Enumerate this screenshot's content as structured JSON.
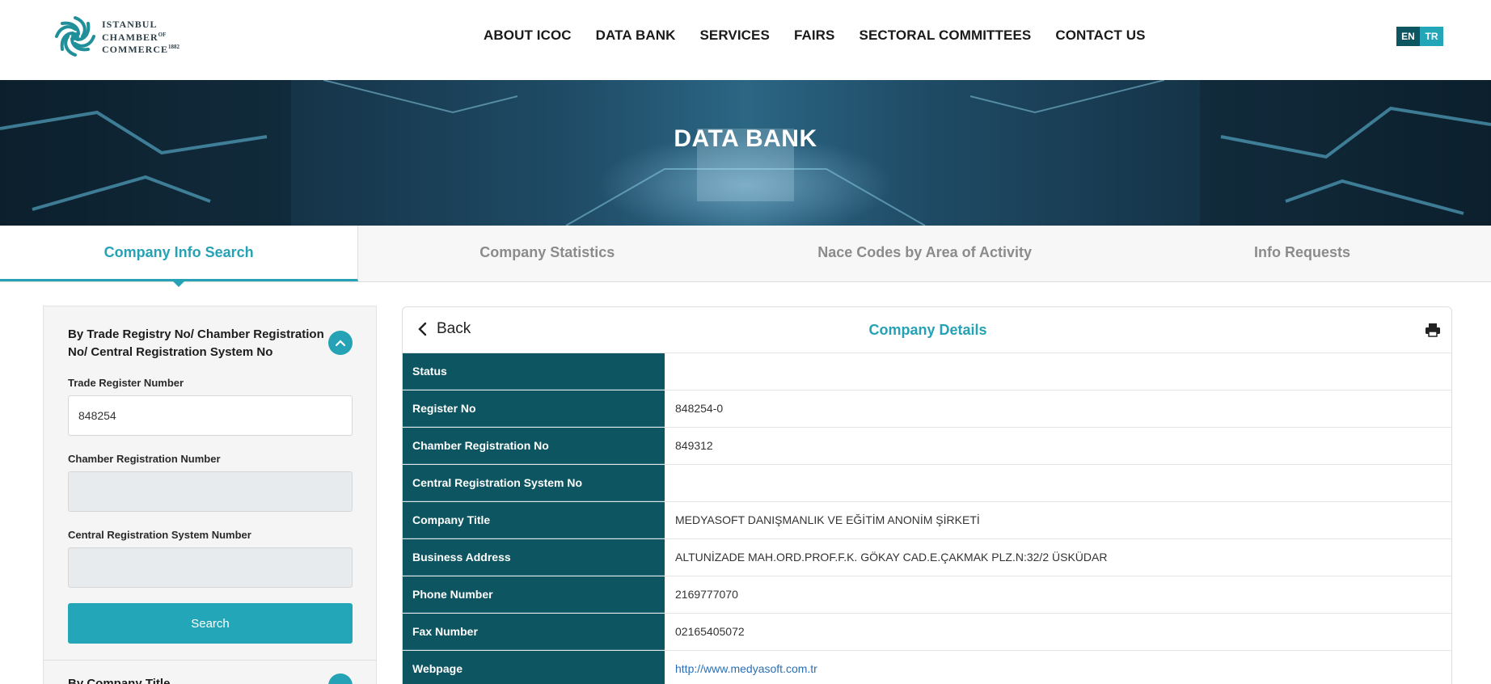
{
  "header": {
    "logo": {
      "line1": "ISTANBUL",
      "line2": "CHAMBER",
      "line2_sup": "OF",
      "line3": "COMMERCE",
      "line3_sup": "1882"
    },
    "nav": [
      {
        "label": "ABOUT ICOC"
      },
      {
        "label": "DATA BANK"
      },
      {
        "label": "SERVICES"
      },
      {
        "label": "FAIRS"
      },
      {
        "label": "SECTORAL COMMITTEES"
      },
      {
        "label": "CONTACT US"
      }
    ],
    "lang": {
      "en": "EN",
      "tr": "TR"
    }
  },
  "hero": {
    "title": "DATA BANK"
  },
  "tabs": [
    {
      "label": "Company Info Search",
      "active": true
    },
    {
      "label": "Company Statistics"
    },
    {
      "label": "Nace Codes by Area of Activity"
    },
    {
      "label": "Info Requests"
    }
  ],
  "search_panel": {
    "section_title": "By Trade Registry No/ Chamber Registration No/ Central Registration System No",
    "trade_register_label": "Trade Register Number",
    "trade_register_value": "848254",
    "chamber_registration_label": "Chamber Registration Number",
    "chamber_registration_value": "",
    "central_registration_label": "Central Registration System Number",
    "central_registration_value": "",
    "search_button": "Search",
    "section2_title": "By Company Title"
  },
  "details": {
    "back_label": "Back",
    "title": "Company Details",
    "rows": [
      {
        "key": "Status",
        "value": ""
      },
      {
        "key": "Register No",
        "value": "848254-0"
      },
      {
        "key": "Chamber Registration No",
        "value": "849312"
      },
      {
        "key": "Central Registration System No",
        "value": ""
      },
      {
        "key": "Company Title",
        "value": "MEDYASOFT DANIŞMANLIK VE EĞİTİM ANONİM ŞİRKETİ"
      },
      {
        "key": "Business Address",
        "value": "ALTUNİZADE MAH.ORD.PROF.F.K. GÖKAY CAD.E.ÇAKMAK PLZ.N:32/2 ÜSKÜDAR"
      },
      {
        "key": "Phone Number",
        "value": "2169777070"
      },
      {
        "key": "Fax Number",
        "value": "02165405072"
      },
      {
        "key": "Webpage",
        "value": "http://www.medyasoft.com.tr"
      }
    ]
  },
  "colors": {
    "accent": "#25a2b5",
    "dark_teal": "#0d5560",
    "link": "#2a6fb5"
  }
}
